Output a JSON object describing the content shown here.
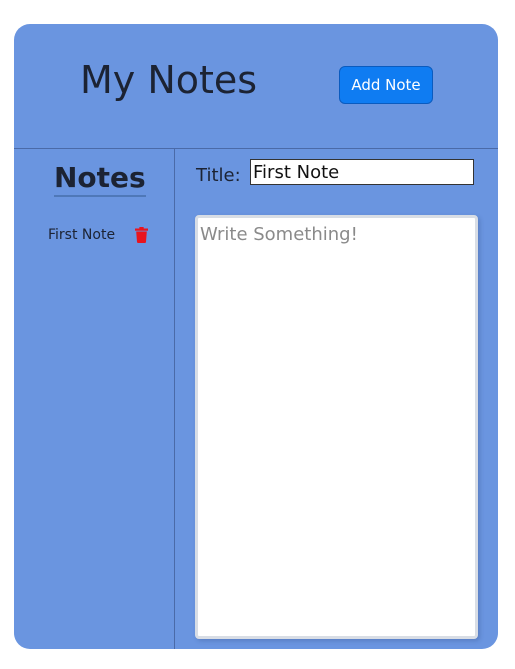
{
  "app": {
    "title": "My Notes",
    "add_button_label": "Add Note"
  },
  "sidebar": {
    "heading": "Notes",
    "notes": [
      {
        "label": "First Note",
        "delete_icon": "trash-icon"
      }
    ]
  },
  "editor": {
    "title_label": "Title:",
    "title_value": "First Note",
    "body_value": "",
    "body_placeholder": "Write Something!"
  },
  "colors": {
    "panel_background": "#6a95e0",
    "button_primary": "#0f7cf2",
    "delete_icon": "#e8141e",
    "text_dark": "#1c2333"
  }
}
